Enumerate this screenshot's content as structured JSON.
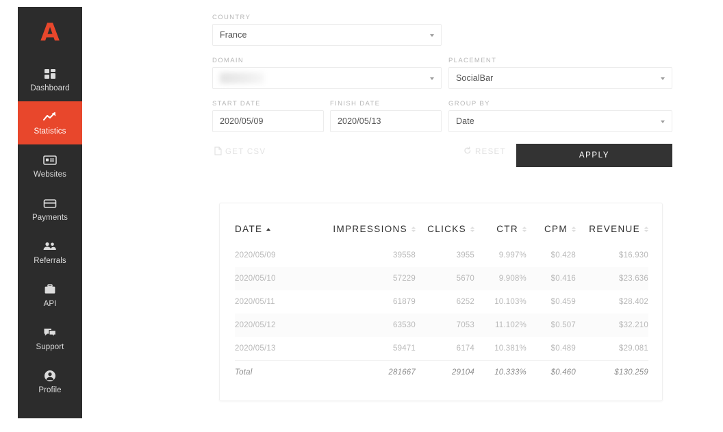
{
  "app": {
    "logo_text": "A",
    "brand_color": "#e8472c",
    "dark_color": "#2c2c2c"
  },
  "sidebar": {
    "items": [
      {
        "label": "Dashboard",
        "icon": "dashboard-grid-icon",
        "active": false
      },
      {
        "label": "Statistics",
        "icon": "line-chart-icon",
        "active": true
      },
      {
        "label": "Websites",
        "icon": "browser-window-icon",
        "active": false
      },
      {
        "label": "Payments",
        "icon": "credit-card-icon",
        "active": false
      },
      {
        "label": "Referrals",
        "icon": "users-group-icon",
        "active": false
      },
      {
        "label": "API",
        "icon": "briefcase-icon",
        "active": false
      },
      {
        "label": "Support",
        "icon": "chat-bubbles-icon",
        "active": false
      },
      {
        "label": "Profile",
        "icon": "user-circle-icon",
        "active": false
      }
    ]
  },
  "filters": {
    "country": {
      "label": "COUNTRY",
      "value": "France"
    },
    "domain": {
      "label": "DOMAIN",
      "value": "",
      "redacted": true
    },
    "placement": {
      "label": "PLACEMENT",
      "value": "SocialBar"
    },
    "start_date": {
      "label": "START DATE",
      "value": "2020/05/09"
    },
    "finish_date": {
      "label": "FINISH DATE",
      "value": "2020/05/13"
    },
    "group_by": {
      "label": "GROUP BY",
      "value": "Date"
    }
  },
  "actions": {
    "get_csv_label": "GET CSV",
    "reset_label": "RESET",
    "apply_label": "APPLY"
  },
  "table": {
    "columns": [
      {
        "label": "DATE",
        "sort": "asc"
      },
      {
        "label": "IMPRESSIONS",
        "sort": "none"
      },
      {
        "label": "CLICKS",
        "sort": "none"
      },
      {
        "label": "CTR",
        "sort": "none"
      },
      {
        "label": "CPM",
        "sort": "none"
      },
      {
        "label": "REVENUE",
        "sort": "none"
      }
    ],
    "rows": [
      {
        "date": "2020/05/09",
        "impressions": "39558",
        "clicks": "3955",
        "ctr": "9.997%",
        "cpm": "$0.428",
        "revenue": "$16.930"
      },
      {
        "date": "2020/05/10",
        "impressions": "57229",
        "clicks": "5670",
        "ctr": "9.908%",
        "cpm": "$0.416",
        "revenue": "$23.636"
      },
      {
        "date": "2020/05/11",
        "impressions": "61879",
        "clicks": "6252",
        "ctr": "10.103%",
        "cpm": "$0.459",
        "revenue": "$28.402"
      },
      {
        "date": "2020/05/12",
        "impressions": "63530",
        "clicks": "7053",
        "ctr": "11.102%",
        "cpm": "$0.507",
        "revenue": "$32.210"
      },
      {
        "date": "2020/05/13",
        "impressions": "59471",
        "clicks": "6174",
        "ctr": "10.381%",
        "cpm": "$0.489",
        "revenue": "$29.081"
      }
    ],
    "total": {
      "date": "Total",
      "impressions": "281667",
      "clicks": "29104",
      "ctr": "10.333%",
      "cpm": "$0.460",
      "revenue": "$130.259"
    }
  }
}
